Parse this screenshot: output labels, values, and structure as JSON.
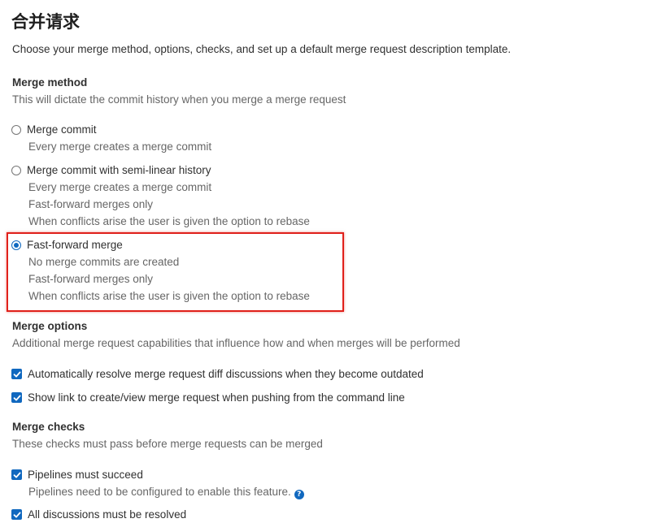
{
  "page": {
    "title": "合并请求",
    "description": "Choose your merge method, options, checks, and set up a default merge request description template."
  },
  "merge_method": {
    "title": "Merge method",
    "description": "This will dictate the commit history when you merge a merge request",
    "options": [
      {
        "label": "Merge commit",
        "checked": false,
        "help": [
          "Every merge creates a merge commit"
        ]
      },
      {
        "label": "Merge commit with semi-linear history",
        "checked": false,
        "help": [
          "Every merge creates a merge commit",
          "Fast-forward merges only",
          "When conflicts arise the user is given the option to rebase"
        ]
      },
      {
        "label": "Fast-forward merge",
        "checked": true,
        "help": [
          "No merge commits are created",
          "Fast-forward merges only",
          "When conflicts arise the user is given the option to rebase"
        ]
      }
    ]
  },
  "merge_options": {
    "title": "Merge options",
    "description": "Additional merge request capabilities that influence how and when merges will be performed",
    "options": [
      {
        "label": "Automatically resolve merge request diff discussions when they become outdated",
        "checked": true
      },
      {
        "label": "Show link to create/view merge request when pushing from the command line",
        "checked": true
      }
    ]
  },
  "merge_checks": {
    "title": "Merge checks",
    "description": "These checks must pass before merge requests can be merged",
    "options": [
      {
        "label": "Pipelines must succeed",
        "checked": true,
        "help": "Pipelines need to be configured to enable this feature.",
        "help_icon": "question-circle-icon"
      },
      {
        "label": "All discussions must be resolved",
        "checked": true
      }
    ]
  },
  "colors": {
    "accent": "#1068bf",
    "highlight": "#e0201a"
  }
}
